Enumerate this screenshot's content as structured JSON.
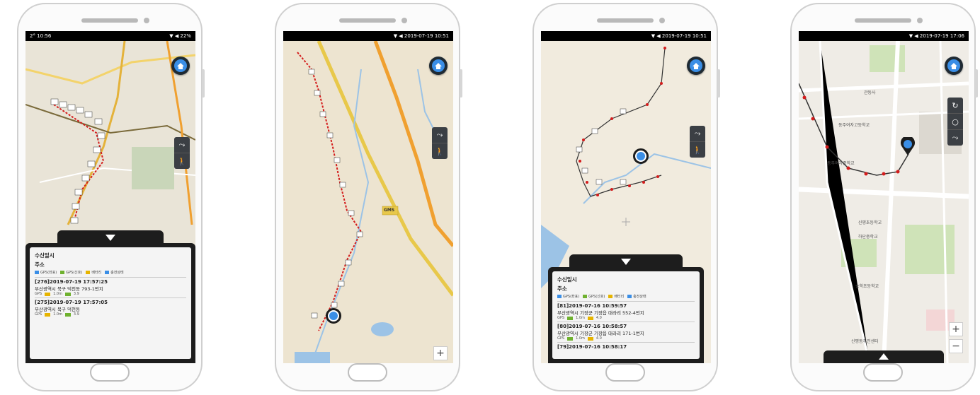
{
  "phones": [
    {
      "status_left": "2° 10:56",
      "status_right": "▼ ◀ 22%",
      "sheet": {
        "title": "수신일시",
        "address_label": "주소",
        "legend": [
          "GPS(좌표)",
          "GPS(신호)",
          "배터리",
          "충전상태"
        ],
        "records": [
          {
            "time": "[276]2019-07-19 17:57:25",
            "place": "부산광역시 북구 덕천동 793-1번지",
            "gps": "GPS",
            "signal": "1.0m",
            "bat": "3.9"
          },
          {
            "time": "[275]2019-07-19 17:57:05",
            "place": "부산광역시 북구 덕천동",
            "gps": "GPS",
            "signal": "1.0m",
            "bat": "3.9"
          }
        ]
      }
    },
    {
      "status_left": "",
      "status_right": "▼ ◀ 2019-07-19 10:51",
      "road_label": "GMS"
    },
    {
      "status_left": "",
      "status_right": "▼ ◀ 2019-07-19 10:51",
      "sheet": {
        "title": "수신일시",
        "address_label": "주소",
        "legend": [
          "GPS(좌표)",
          "GPS(신호)",
          "배터리",
          "충전상태"
        ],
        "records": [
          {
            "time": "[81]2019-07-16 10:59:57",
            "place": "부산광역시 기장군 기장읍 대라리 552-4번지",
            "gps": "GPS",
            "signal": "1.0m",
            "bat": "4.0"
          },
          {
            "time": "[80]2019-07-16 10:58:57",
            "place": "부산광역시 기장군 기장읍 대라리 171-1번지",
            "gps": "GPS",
            "signal": "1.0m",
            "bat": "4.0"
          },
          {
            "time": "[79]2019-07-16 10:58:17",
            "place": "",
            "gps": "",
            "signal": "",
            "bat": ""
          }
        ]
      }
    },
    {
      "status_left": "",
      "status_right": "▼ ◀ 2019-07-19 17:06",
      "labels": [
        "관동사",
        "동주여자고등학교",
        "동주여자중학교",
        "신평초등학교",
        "하단중학교",
        "승학초등학교",
        "신평동주민센터"
      ],
      "zoom_plus": "+",
      "zoom_minus": "−"
    }
  ],
  "colors": {
    "route": "#d41c1c",
    "marker_blue": "#3a8ee6",
    "road_yellow": "#e8c84a",
    "road_orange": "#f0a030",
    "water": "#9cc3e6"
  }
}
